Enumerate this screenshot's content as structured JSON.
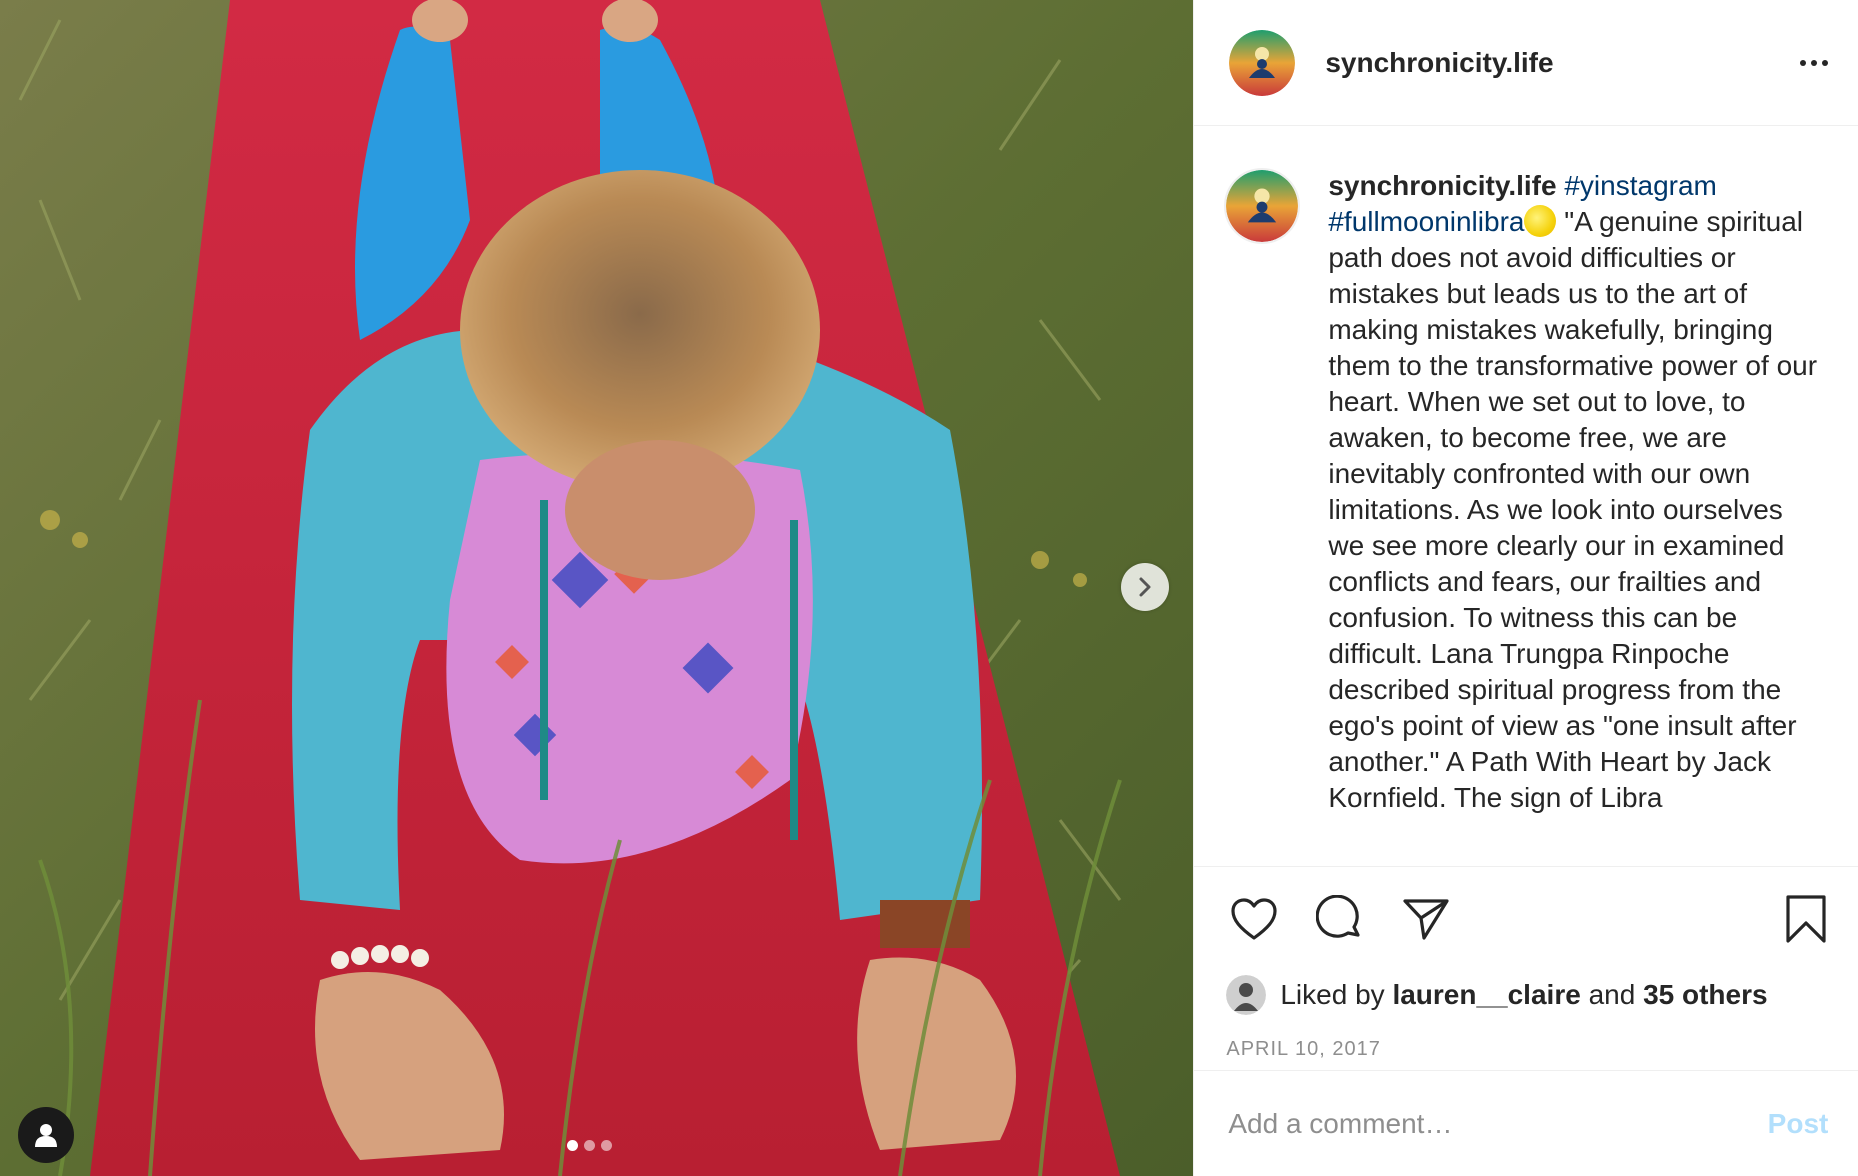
{
  "account": {
    "username": "synchronicity.life"
  },
  "media": {
    "total_slides": 3,
    "current_slide": 1
  },
  "caption": {
    "username": "synchronicity.life",
    "hashtags": [
      "#yinstagram",
      "#fullmooninlibra"
    ],
    "text": "\"A genuine spiritual path does not avoid difficulties or mistakes but leads us to the art of making mistakes wakefully, bringing them to the transformative power of our heart. When we set out to love, to awaken, to become free, we are inevitably confronted with our own limitations. As we look into ourselves we see more clearly our in examined conflicts and fears, our frailties and confusion. To witness this can be difficult. Lana Trungpa Rinpoche described spiritual progress from the ego's point of view as \"one insult after another.\" A Path With Heart by Jack Kornfield. The sign of Libra"
  },
  "likes": {
    "prefix": "Liked by",
    "user": "lauren__claire",
    "joiner": "and",
    "others": "35 others"
  },
  "date": "APRIL 10, 2017",
  "comment": {
    "placeholder": "Add a comment…",
    "post_label": "Post"
  },
  "colors": {
    "hashtag": "#00376b",
    "post_disabled": "#b2dffc",
    "date": "#8e8e8e",
    "mat": "#c8283b",
    "leggings": "#2a9be0"
  }
}
